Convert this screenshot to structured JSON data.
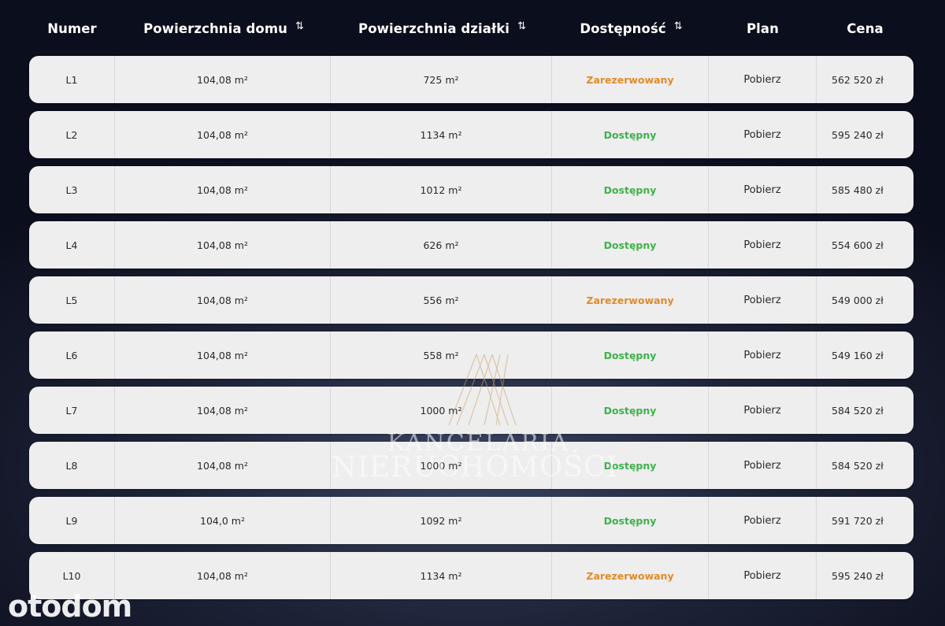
{
  "header": {
    "numer": "Numer",
    "house_area": "Powierzchnia domu",
    "plot_area": "Powierzchnia działki",
    "availability": "Dostępność",
    "plan": "Plan",
    "price": "Cena",
    "sort_icon_glyph": "⇅"
  },
  "rows": [
    {
      "numer": "L1",
      "house_area": "104,08 m²",
      "plot_area": "725 m²",
      "availability": "Zarezerwowany",
      "status": "reserved",
      "plan": "Pobierz",
      "price": "562 520 zł"
    },
    {
      "numer": "L2",
      "house_area": "104,08 m²",
      "plot_area": "1134 m²",
      "availability": "Dostępny",
      "status": "available",
      "plan": "Pobierz",
      "price": "595 240 zł"
    },
    {
      "numer": "L3",
      "house_area": "104,08 m²",
      "plot_area": "1012 m²",
      "availability": "Dostępny",
      "status": "available",
      "plan": "Pobierz",
      "price": "585 480 zł"
    },
    {
      "numer": "L4",
      "house_area": "104,08 m²",
      "plot_area": "626 m²",
      "availability": "Dostępny",
      "status": "available",
      "plan": "Pobierz",
      "price": "554 600 zł"
    },
    {
      "numer": "L5",
      "house_area": "104,08 m²",
      "plot_area": "556 m²",
      "availability": "Zarezerwowany",
      "status": "reserved",
      "plan": "Pobierz",
      "price": "549 000 zł"
    },
    {
      "numer": "L6",
      "house_area": "104,08 m²",
      "plot_area": "558 m²",
      "availability": "Dostępny",
      "status": "available",
      "plan": "Pobierz",
      "price": "549 160 zł"
    },
    {
      "numer": "L7",
      "house_area": "104,08 m²",
      "plot_area": "1000 m²",
      "availability": "Dostępny",
      "status": "available",
      "plan": "Pobierz",
      "price": "584 520 zł"
    },
    {
      "numer": "L8",
      "house_area": "104,08 m²",
      "plot_area": "1000 m²",
      "availability": "Dostępny",
      "status": "available",
      "plan": "Pobierz",
      "price": "584 520 zł"
    },
    {
      "numer": "L9",
      "house_area": "104,0 m²",
      "plot_area": "1092 m²",
      "availability": "Dostępny",
      "status": "available",
      "plan": "Pobierz",
      "price": "591 720 zł"
    },
    {
      "numer": "L10",
      "house_area": "104,08 m²",
      "plot_area": "1134 m²",
      "availability": "Zarezerwowany",
      "status": "reserved",
      "plan": "Pobierz",
      "price": "595 240 zł"
    }
  ],
  "colors": {
    "available": "#3fb14a",
    "reserved": "#e08a2a",
    "background": "#11152a",
    "row_bg": "#eeeeef"
  },
  "watermark": {
    "line1": "KANCELARIA",
    "line2": "NIERUCHOMOŚCI"
  },
  "brand": {
    "logo_text": "otodom"
  }
}
